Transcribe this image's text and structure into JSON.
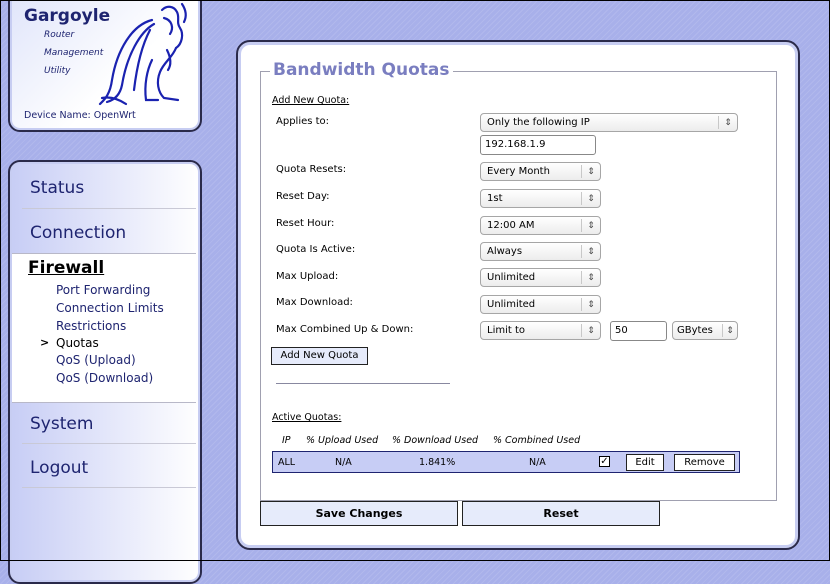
{
  "header": {
    "brand": "Gargoyle",
    "tagline": [
      "Router",
      "Management",
      "Utility"
    ],
    "device_name": "Device Name:  OpenWrt"
  },
  "nav": {
    "items": [
      {
        "label": "Status"
      },
      {
        "label": "Connection"
      },
      {
        "label": "Firewall",
        "active": true
      },
      {
        "label": "System"
      },
      {
        "label": "Logout"
      }
    ],
    "firewall_sub": [
      {
        "label": "Port Forwarding"
      },
      {
        "label": "Connection Limits"
      },
      {
        "label": "Restrictions"
      },
      {
        "label": "Quotas",
        "active": true
      },
      {
        "label": "QoS (Upload)"
      },
      {
        "label": "QoS (Download)"
      }
    ],
    "active_marker": ">"
  },
  "main": {
    "title": "Bandwidth Quotas",
    "add_section_label": "Add New Quota:",
    "form": {
      "applies_to": {
        "label": "Applies to:",
        "value": "Only the following IP"
      },
      "ip": {
        "value": "192.168.1.9"
      },
      "quota_resets": {
        "label": "Quota Resets:",
        "value": "Every Month"
      },
      "reset_day": {
        "label": "Reset Day:",
        "value": "1st"
      },
      "reset_hour": {
        "label": "Reset Hour:",
        "value": "12:00 AM"
      },
      "quota_active": {
        "label": "Quota Is Active:",
        "value": "Always"
      },
      "max_upload": {
        "label": "Max Upload:",
        "value": "Unlimited"
      },
      "max_download": {
        "label": "Max Download:",
        "value": "Unlimited"
      },
      "max_combined": {
        "label": "Max Combined Up & Down:",
        "value": "Limit to",
        "amount": "50",
        "unit": "GBytes"
      }
    },
    "add_button": "Add New Quota",
    "active_section_label": "Active Quotas:",
    "table": {
      "headers": [
        "IP",
        "% Upload Used",
        "% Download Used",
        "% Combined Used"
      ],
      "rows": [
        {
          "ip": "ALL",
          "upload": "N/A",
          "download": "1.841%",
          "combined": "N/A",
          "enabled": true,
          "edit": "Edit",
          "remove": "Remove"
        }
      ]
    },
    "save_button": "Save Changes",
    "reset_button": "Reset"
  },
  "icons": {
    "select_arrow": "⇕",
    "check": "✓"
  }
}
